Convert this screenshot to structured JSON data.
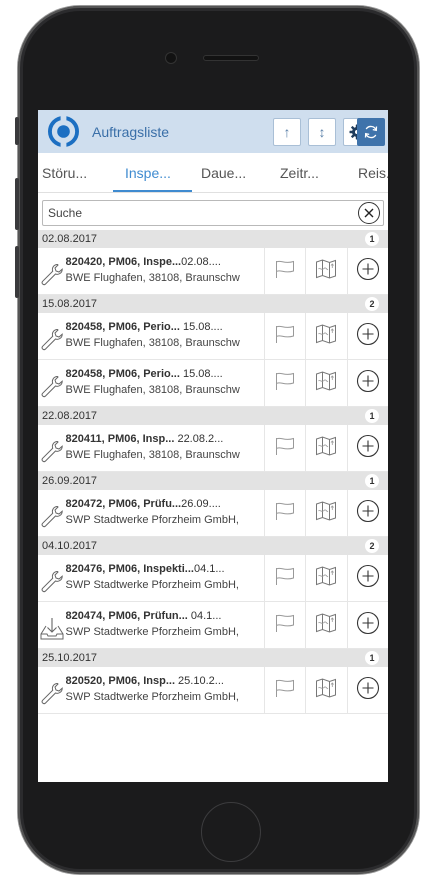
{
  "app": {
    "title": "Auftragsliste",
    "colors": {
      "header_bg": "#cfdeee",
      "accent": "#3f8bd0",
      "dark_button": "#3f73ab"
    }
  },
  "toolbar": {
    "buttons": [
      {
        "icon": "arrow-up-icon",
        "glyph": "↑"
      },
      {
        "icon": "sort-icon",
        "glyph": "↕"
      },
      {
        "icon": "gear-icon",
        "glyph": "⚙"
      },
      {
        "icon": "refresh-icon",
        "glyph": ""
      }
    ]
  },
  "tabs": [
    {
      "label": "Störu...",
      "active": false
    },
    {
      "label": "Inspe...",
      "active": true
    },
    {
      "label": "Daue...",
      "active": false
    },
    {
      "label": "Zeitr...",
      "active": false
    },
    {
      "label": "Reis...",
      "active": false
    }
  ],
  "search": {
    "placeholder": "Suche",
    "value": ""
  },
  "groups": [
    {
      "date": "02.08.2017",
      "count": "1",
      "items": [
        {
          "icon": "wrench-icon",
          "title": "820420, PM06, Inspe...",
          "date": "02.08....",
          "address": "BWE Flughafen, 38108, Braunschw"
        }
      ]
    },
    {
      "date": "15.08.2017",
      "count": "2",
      "items": [
        {
          "icon": "wrench-icon",
          "title": "820458, PM06, Perio...",
          "date": " 15.08....",
          "address": "BWE Flughafen, 38108, Braunschw"
        },
        {
          "icon": "wrench-icon",
          "title": "820458, PM06, Perio...",
          "date": " 15.08....",
          "address": "BWE Flughafen, 38108, Braunschw"
        }
      ]
    },
    {
      "date": "22.08.2017",
      "count": "1",
      "items": [
        {
          "icon": "wrench-icon",
          "title": "820411, PM06, Insp...",
          "date": " 22.08.2...",
          "address": "BWE Flughafen, 38108, Braunschw"
        }
      ]
    },
    {
      "date": "26.09.2017",
      "count": "1",
      "items": [
        {
          "icon": "wrench-icon",
          "title": "820472, PM06, Prüfu...",
          "date": "26.09....",
          "address": "SWP Stadtwerke Pforzheim GmbH,"
        }
      ]
    },
    {
      "date": "04.10.2017",
      "count": "2",
      "items": [
        {
          "icon": "wrench-icon",
          "title": "820476, PM06, Inspekti...",
          "date": "04.1...",
          "address": "SWP Stadtwerke Pforzheim GmbH,"
        },
        {
          "icon": "download-tray-icon",
          "title": "820474, PM06, Prüfun...",
          "date": " 04.1...",
          "address": "SWP Stadtwerke Pforzheim GmbH,"
        }
      ]
    },
    {
      "date": "25.10.2017",
      "count": "1",
      "items": [
        {
          "icon": "wrench-icon",
          "title": "820520, PM06, Insp...",
          "date": " 25.10.2...",
          "address": "SWP Stadtwerke Pforzheim GmbH,"
        }
      ]
    }
  ]
}
